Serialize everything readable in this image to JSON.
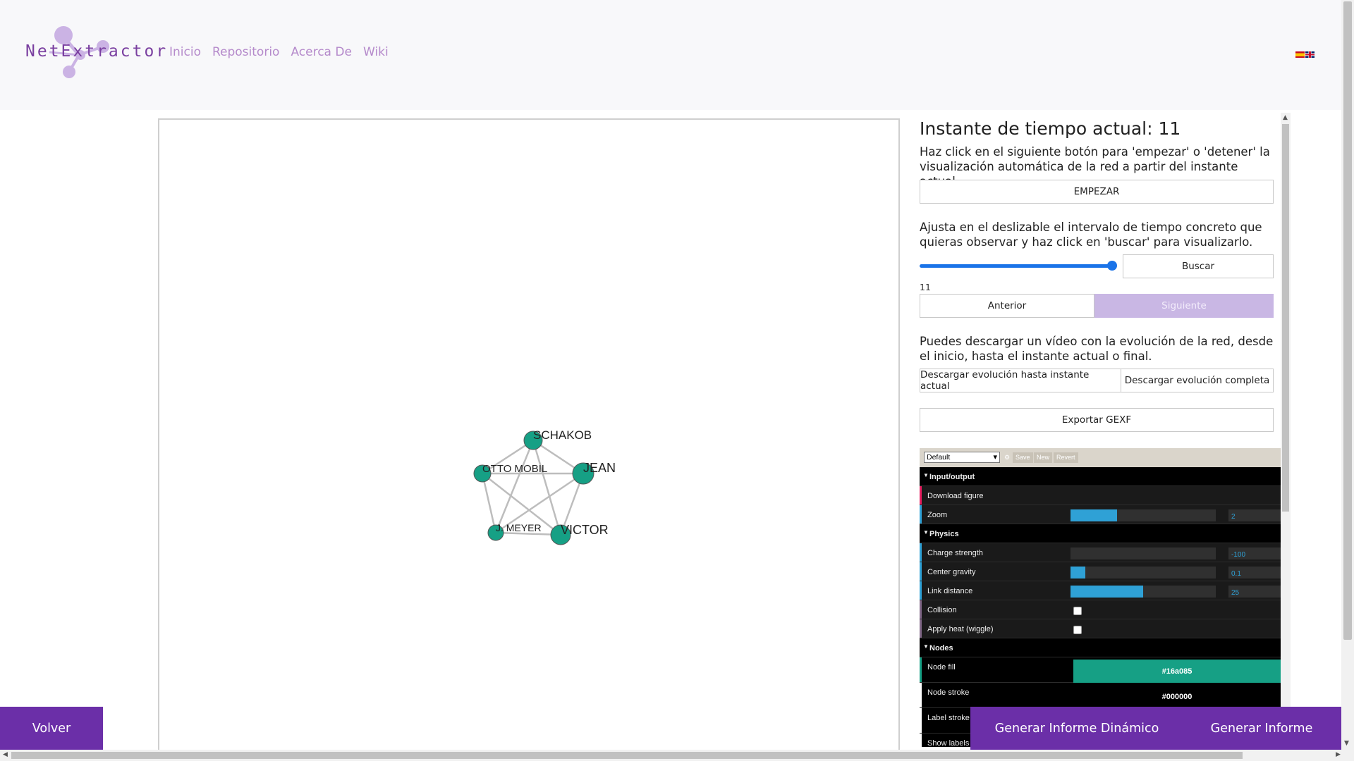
{
  "header": {
    "logo_text": "NetExtractor",
    "nav": [
      "Inicio",
      "Repositorio",
      "Acerca De",
      "Wiki"
    ],
    "colors": {
      "nav": "#b58acb",
      "logo": "#7a3fa0"
    }
  },
  "graph": {
    "nodes": [
      {
        "id": "SCHAKOB",
        "label": "SCHAKOB"
      },
      {
        "id": "OTTO",
        "label": "OTTO MOBIL"
      },
      {
        "id": "JEAN",
        "label": "JEAN"
      },
      {
        "id": "MEYER",
        "label": "J. MEYER"
      },
      {
        "id": "VICTOR",
        "label": "VICTOR"
      }
    ],
    "node_color": "#16a085"
  },
  "panel": {
    "title": "Instante de tiempo actual: 11",
    "intro": "Haz click en el siguiente botón para 'empezar' o 'detener' la visualización automática de la red a partir del instante actual.",
    "start_button": "EMPEZAR",
    "slider_text": "Ajusta en el deslizable el intervalo de tiempo concreto que quieras observar y haz click en 'buscar' para visualizarlo.",
    "search_button": "Buscar",
    "slider_value": "11",
    "prev_button": "Anterior",
    "next_button": "Siguiente",
    "video_text": "Puedes descargar un vídeo con la evolución de la red, desde el inicio, hasta el instante actual o final.",
    "download_current": "Descargar evolución hasta instante actual",
    "download_full": "Descargar evolución completa",
    "export_button": "Exportar GEXF"
  },
  "gui": {
    "preset": "Default",
    "save": "Save",
    "new": "New",
    "revert": "Revert",
    "input_output": "Input/output",
    "download_figure": "Download figure",
    "zoom": "Zoom",
    "zoom_value": "2",
    "zoom_level": 0.32,
    "physics": "Physics",
    "charge_strength": "Charge strength",
    "charge_value": "-100",
    "charge_level": 0,
    "center_gravity": "Center gravity",
    "center_value": "0.1",
    "center_level": 0.1,
    "link_distance": "Link distance",
    "link_value": "25",
    "link_level": 0.5,
    "collision": "Collision",
    "apply_heat": "Apply heat (wiggle)",
    "nodes": "Nodes",
    "node_fill": "Node fill",
    "node_fill_value": "#16a085",
    "node_stroke": "Node stroke",
    "node_stroke_value": "#000000",
    "label_stroke": "Label stroke",
    "show_labels": "Show labels"
  },
  "footer": {
    "back": "Volver",
    "dynamic_report": "Generar Informe Dinámico",
    "report": "Generar Informe"
  }
}
